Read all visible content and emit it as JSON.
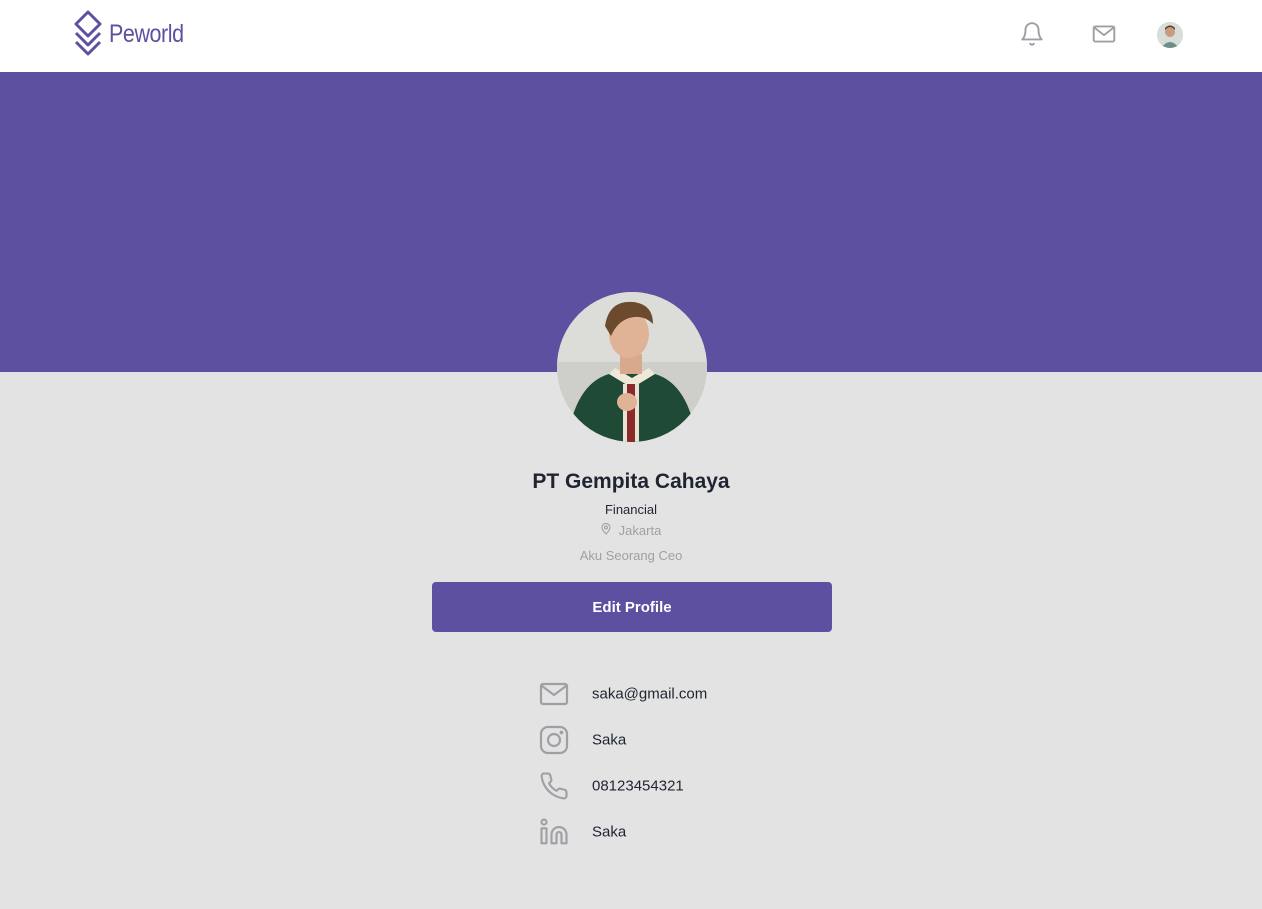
{
  "navbar": {
    "logo_text": "Peworld",
    "brand_color": "#5e50a1",
    "icons": [
      "bell-icon",
      "mail-icon",
      "user-avatar"
    ]
  },
  "banner": {
    "color": "#5e50a1"
  },
  "profile": {
    "name": "PT Gempita Cahaya",
    "industry": "Financial",
    "location": "Jakarta",
    "bio": "Aku Seorang Ceo",
    "edit_label": "Edit Profile"
  },
  "contacts": {
    "email": "saka@gmail.com",
    "instagram": "Saka",
    "phone": "08123454321",
    "linkedin": "Saka"
  }
}
